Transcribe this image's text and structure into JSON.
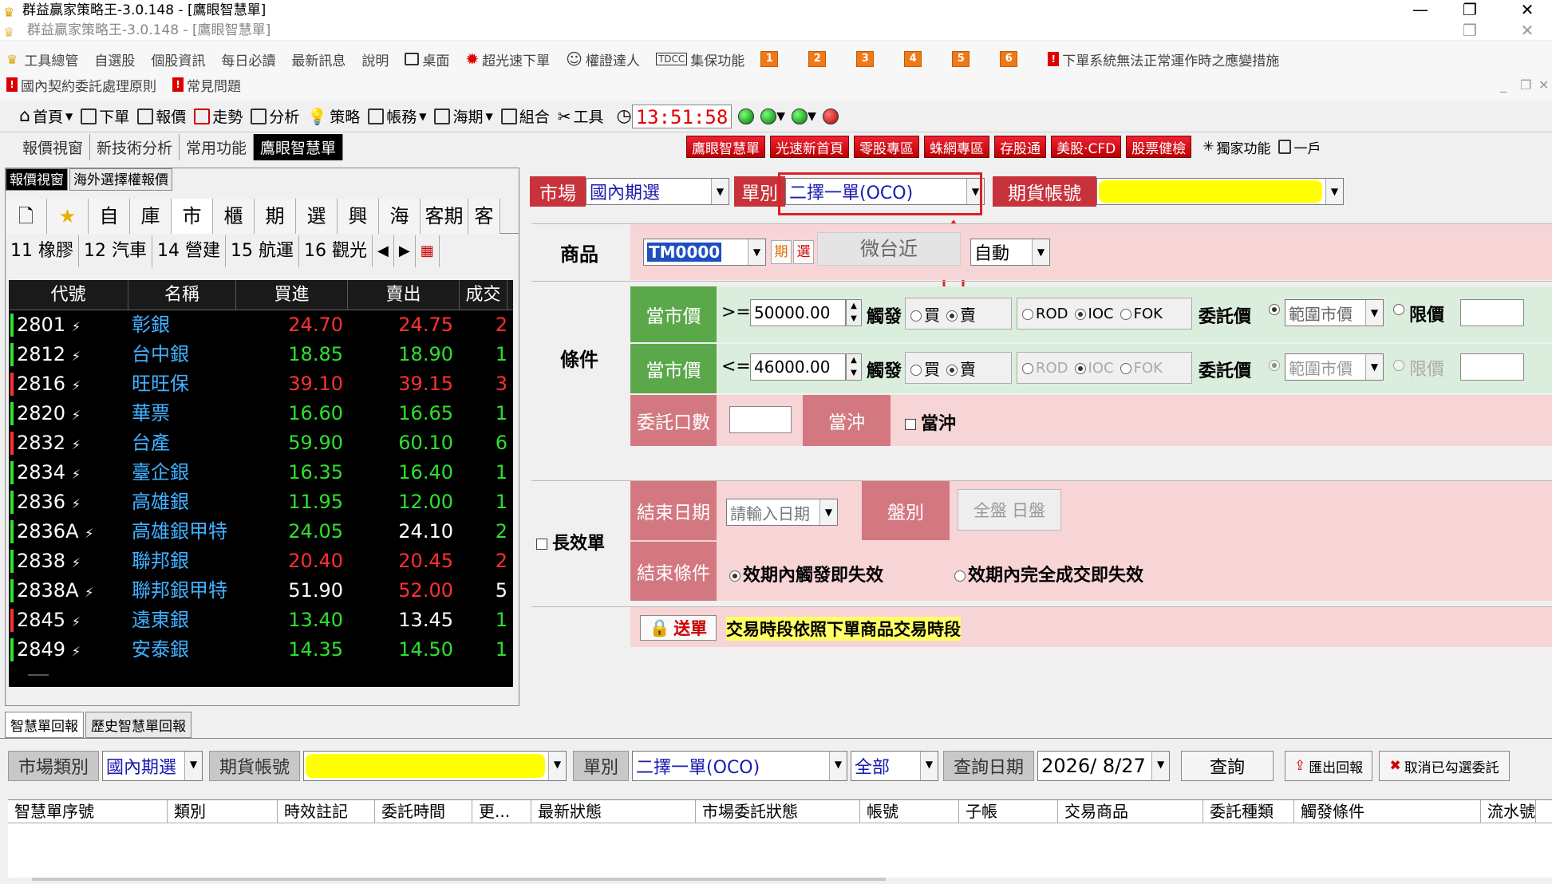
{
  "window": {
    "title": "群益贏家策略王-3.0.148 - [鷹眼智慧單]",
    "subtitle": "群益贏家策略王-3.0.148 - [鷹眼智慧單]",
    "minimize": "—",
    "restore": "❐",
    "close": "✕"
  },
  "menu": {
    "items": [
      "工具總管",
      "自選股",
      "個股資訊",
      "每日必讀",
      "最新訊息",
      "說明",
      "桌面",
      "超光速下單",
      "權證達人",
      "集保功能"
    ],
    "numbers": [
      "1",
      "2",
      "3",
      "4",
      "5",
      "6"
    ],
    "notice": "下單系統無法正常運作時之應變措施",
    "row2": [
      "國內契約委託處理原則",
      "常見問題"
    ]
  },
  "toolbar": {
    "items": [
      "首頁",
      "下單",
      "報價",
      "走勢",
      "分析",
      "策略",
      "帳務",
      "海期",
      "組合",
      "工具"
    ],
    "clock": "13:51:58"
  },
  "tabs": {
    "left": [
      "報價視窗",
      "新技術分析",
      "常用功能",
      "鷹眼智慧單"
    ],
    "promo": [
      "鷹眼智慧單",
      "光速新首頁",
      "零股專區",
      "蛛網專區",
      "存股通",
      "美股·CFD",
      "股票健檢"
    ],
    "extra": [
      "獨家功能",
      "一戶"
    ]
  },
  "leftpanel": {
    "tabs": [
      "報價視窗",
      "海外選擇權報價"
    ],
    "categories": [
      "自",
      "庫",
      "市",
      "櫃",
      "期",
      "選",
      "興",
      "海",
      "客期",
      "客選"
    ],
    "industries": [
      "11 橡膠",
      "12 汽車",
      "14 營建",
      "15 航運",
      "16 觀光"
    ],
    "headers": [
      "代號",
      "名稱",
      "買進",
      "賣出",
      "成交"
    ],
    "rows": [
      {
        "code": "2801",
        "name": "彰銀",
        "bid": "24.70",
        "ask": "24.75",
        "last": "2",
        "bc": "r",
        "ac": "r",
        "bar": "g"
      },
      {
        "code": "2812",
        "name": "台中銀",
        "bid": "18.85",
        "ask": "18.90",
        "last": "1",
        "bc": "g",
        "ac": "g",
        "bar": "g"
      },
      {
        "code": "2816",
        "name": "旺旺保",
        "bid": "39.10",
        "ask": "39.15",
        "last": "3",
        "bc": "r",
        "ac": "r",
        "bar": "r"
      },
      {
        "code": "2820",
        "name": "華票",
        "bid": "16.60",
        "ask": "16.65",
        "last": "1",
        "bc": "g",
        "ac": "g",
        "bar": "g"
      },
      {
        "code": "2832",
        "name": "台產",
        "bid": "59.90",
        "ask": "60.10",
        "last": "6",
        "bc": "g",
        "ac": "g",
        "bar": "r"
      },
      {
        "code": "2834",
        "name": "臺企銀",
        "bid": "16.35",
        "ask": "16.40",
        "last": "1",
        "bc": "g",
        "ac": "g",
        "bar": "g"
      },
      {
        "code": "2836",
        "name": "高雄銀",
        "bid": "11.95",
        "ask": "12.00",
        "last": "1",
        "bc": "g",
        "ac": "g",
        "bar": "g"
      },
      {
        "code": "2836A",
        "name": "高雄銀甲特",
        "bid": "24.05",
        "ask": "24.10",
        "last": "2",
        "bc": "g",
        "ac": "w",
        "bar": "g"
      },
      {
        "code": "2838",
        "name": "聯邦銀",
        "bid": "20.40",
        "ask": "20.45",
        "last": "2",
        "bc": "r",
        "ac": "r",
        "bar": "g"
      },
      {
        "code": "2838A",
        "name": "聯邦銀甲特",
        "bid": "51.90",
        "ask": "52.00",
        "last": "5",
        "bc": "w",
        "ac": "r",
        "bar": "g"
      },
      {
        "code": "2845",
        "name": "遠東銀",
        "bid": "13.40",
        "ask": "13.45",
        "last": "1",
        "bc": "g",
        "ac": "w",
        "bar": "r"
      },
      {
        "code": "2849",
        "name": "安泰銀",
        "bid": "14.35",
        "ask": "14.50",
        "last": "1",
        "bc": "g",
        "ac": "g",
        "bar": "g"
      }
    ]
  },
  "order": {
    "market_label": "市場",
    "market_value": "國內期選",
    "type_label": "單別",
    "type_value": "二擇一單(OCO)",
    "account_label": "期貨帳號",
    "product_label": "商品",
    "product_code": "TM0000",
    "fut": "期",
    "opt": "選",
    "product_name": "微台近",
    "auto": "自動",
    "cond_label": "條件",
    "price_label": "當市價",
    "c1_op": ">=",
    "c1_val": "50000.00",
    "c2_op": "<=",
    "c2_val": "46000.00",
    "trigger": "觸發",
    "buy": "買",
    "sell": "賣",
    "rod": "ROD",
    "ioc": "IOC",
    "fok": "FOK",
    "price_type_label": "委託價",
    "range_mkt": "範圍市價",
    "limit": "限價",
    "qty_label": "委託口數",
    "daytrade_label": "當沖",
    "daytrade_chk": "當沖",
    "long_label": "長效單",
    "end_date_label": "結束日期",
    "end_date_ph": "請輸入日期",
    "session_label": "盤別",
    "session_all": "全盤",
    "session_day": "日盤",
    "end_cond_label": "結束條件",
    "end_opt1": "效期內觸發即失效",
    "end_opt2": "效期內完全成交即失效",
    "send": "送單",
    "send_note": "交易時段依照下單商品交易時段"
  },
  "bottom": {
    "tabs": [
      "智慧單回報",
      "歷史智慧單回報"
    ],
    "market_label": "市場類別",
    "market_value": "國內期選",
    "account_label": "期貨帳號",
    "type_label": "單別",
    "type_value": "二擇一單(OCO)",
    "status_value": "全部",
    "date_label": "查詢日期",
    "date_value": "2026/  8/27",
    "query": "查詢",
    "export": "匯出回報",
    "cancel": "取消已勾選委託",
    "headers": [
      "智慧單序號",
      "類別",
      "時效註記",
      "委託時間",
      "更...",
      "最新狀態",
      "市場委託狀態",
      "帳號",
      "子帳",
      "交易商品",
      "委託種類",
      "觸發條件",
      "流水號"
    ]
  }
}
